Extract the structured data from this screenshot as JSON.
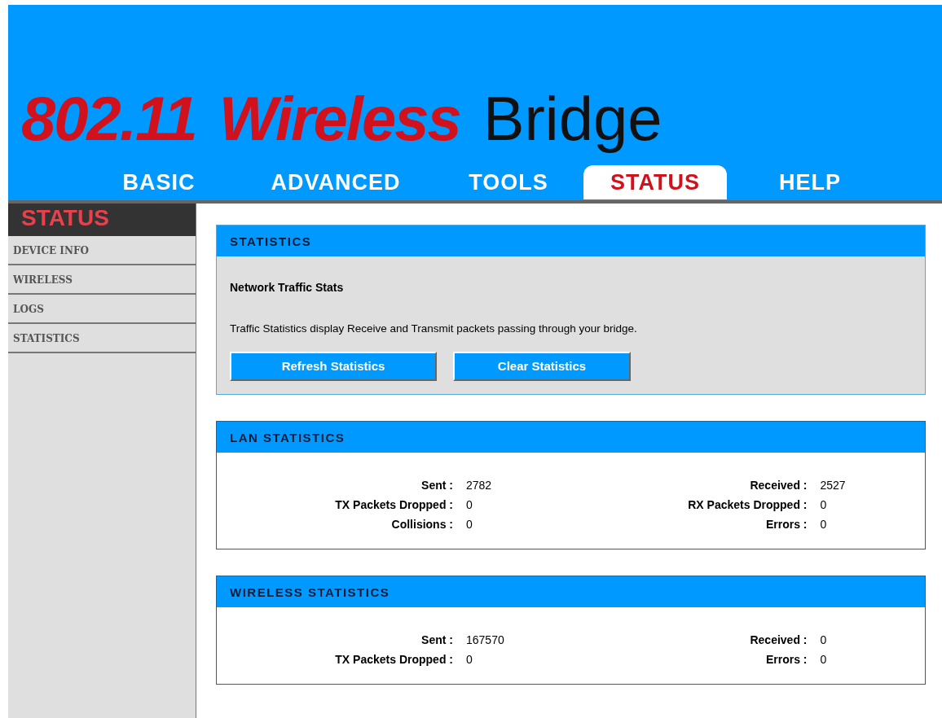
{
  "logo": [
    {
      "text": "802.11",
      "kind": "accent"
    },
    {
      "text": "Wireless",
      "kind": "accent"
    },
    {
      "text": "Bridge",
      "kind": "plain"
    }
  ],
  "tabs": [
    {
      "label": "BASIC",
      "selected": false
    },
    {
      "label": "ADVANCED",
      "selected": false
    },
    {
      "label": "TOOLS",
      "selected": false
    },
    {
      "label": "STATUS",
      "selected": true
    },
    {
      "label": "HELP",
      "selected": false
    }
  ],
  "sidebar": {
    "title": "STATUS",
    "items": [
      "DEVICE INFO",
      "WIRELESS",
      "LOGS",
      "STATISTICS"
    ]
  },
  "intro": {
    "title": "STATISTICS",
    "heading": "Network Traffic Stats",
    "text": "Traffic Statistics display Receive and Transmit packets passing through your bridge.",
    "buttons": [
      "Refresh Statistics",
      "Clear Statistics"
    ]
  },
  "sections": [
    {
      "title": "LAN STATISTICS",
      "columns": [
        [
          {
            "label": "Sent :",
            "value": "2782"
          },
          {
            "label": "TX Packets Dropped :",
            "value": "0"
          },
          {
            "label": "Collisions :",
            "value": "0"
          }
        ],
        [
          {
            "label": "Received :",
            "value": "2527"
          },
          {
            "label": "RX Packets Dropped :",
            "value": "0"
          },
          {
            "label": "Errors :",
            "value": "0"
          }
        ]
      ]
    },
    {
      "title": "WIRELESS STATISTICS",
      "columns": [
        [
          {
            "label": "Sent :",
            "value": "167570"
          },
          {
            "label": "TX Packets Dropped :",
            "value": "0"
          }
        ],
        [
          {
            "label": "Received :",
            "value": "0"
          },
          {
            "label": "Errors :",
            "value": "0"
          }
        ]
      ]
    }
  ]
}
